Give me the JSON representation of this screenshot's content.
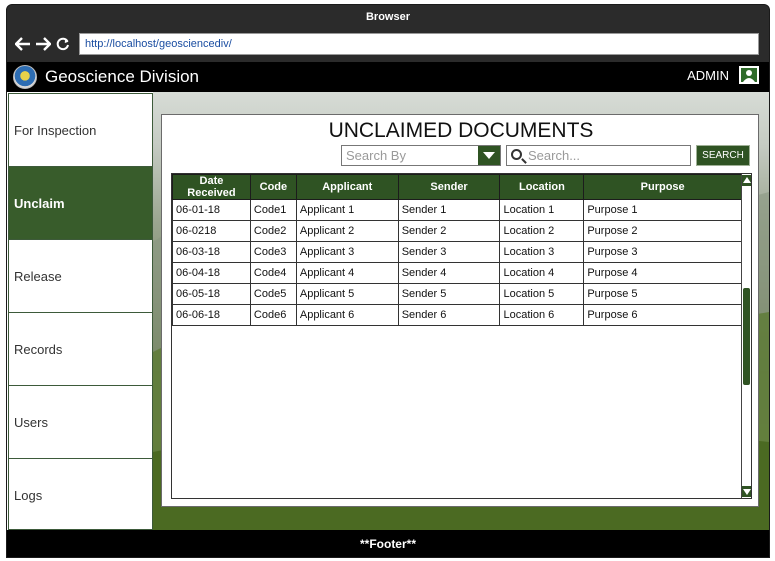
{
  "browser": {
    "window_title": "Browser",
    "url": "http://localhost/geosciencediv/"
  },
  "header": {
    "app_title": "Geoscience Division",
    "user_label": "ADMIN"
  },
  "sidebar": {
    "items": [
      {
        "label": "For Inspection"
      },
      {
        "label": "Unclaim"
      },
      {
        "label": "Release"
      },
      {
        "label": "Records"
      },
      {
        "label": "Users"
      },
      {
        "label": "Logs"
      }
    ],
    "active": "Unclaim"
  },
  "main": {
    "title": "UNCLAIMED DOCUMENTS",
    "search_by_placeholder": "Search By",
    "search_placeholder": "Search...",
    "search_button": "SEARCH",
    "table": {
      "columns": [
        "Date Received",
        "Code",
        "Applicant",
        "Sender",
        "Location",
        "Purpose"
      ],
      "rows": [
        [
          "06-01-18",
          "Code1",
          "Applicant 1",
          "Sender 1",
          "Location 1",
          "Purpose 1"
        ],
        [
          "06-0218",
          "Code2",
          "Applicant 2",
          "Sender 2",
          "Location 2",
          "Purpose 2"
        ],
        [
          "06-03-18",
          "Code3",
          "Applicant 3",
          "Sender 3",
          "Location 3",
          "Purpose 3"
        ],
        [
          "06-04-18",
          "Code4",
          "Applicant 4",
          "Sender 4",
          "Location 4",
          "Purpose 4"
        ],
        [
          "06-05-18",
          "Code5",
          "Applicant 5",
          "Sender 5",
          "Location 5",
          "Purpose 5"
        ],
        [
          "06-06-18",
          "Code6",
          "Applicant 6",
          "Sender 6",
          "Location 6",
          "Purpose 6"
        ]
      ]
    }
  },
  "footer": {
    "text": "**Footer**"
  },
  "colors": {
    "accent_green": "#2f5323",
    "sidebar_active": "#385c2b",
    "header_bg": "#000000"
  },
  "icons": {
    "back": "arrow-left-icon",
    "forward": "arrow-right-icon",
    "reload": "reload-icon",
    "logo": "division-logo",
    "user": "user-icon",
    "dropdown": "chevron-down-icon",
    "search": "search-icon"
  }
}
